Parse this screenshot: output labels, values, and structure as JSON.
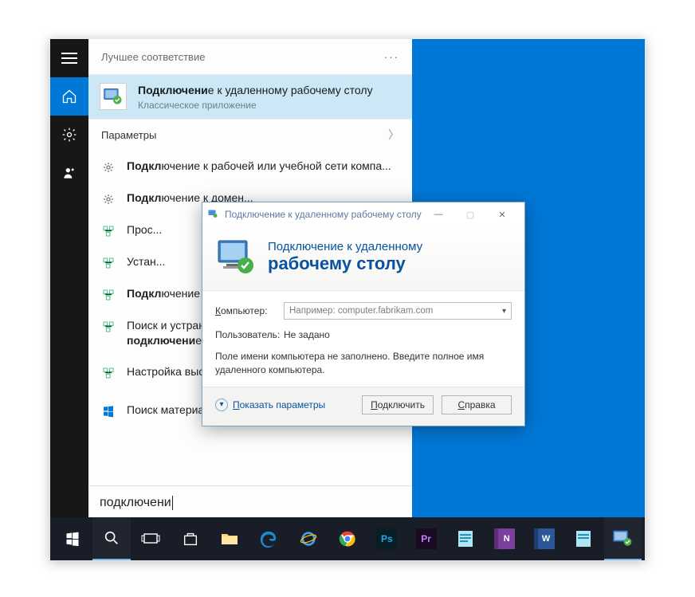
{
  "start": {
    "best_match_header": "Лучшее соответствие",
    "best_match_title_bold": "Подключени",
    "best_match_title_rest": "е к удаленному рабочему столу",
    "best_match_subtitle": "Классическое приложение",
    "params_header": "Параметры",
    "results": [
      "Подкл... компа...",
      "Подкл... домен...",
      "Прос...",
      "Устан...",
      "Подкл... стола...",
      "Поиск и устранение проблем с сетью и подключением",
      "Настройка высокоскоростного подключения"
    ],
    "store_header": "Поиск материалов",
    "search_query": "подключени"
  },
  "rdp": {
    "title": "Подключение к удаленному рабочему столу",
    "banner_line1": "Подключение к удаленному",
    "banner_line2": "рабочему столу",
    "label_computer": "Компьютер:",
    "label_computer_u": "К",
    "label_computer_rest": "омпьютер:",
    "combo_placeholder": "Например: computer.fabrikam.com",
    "label_user": "Пользователь:",
    "user_value": "Не задано",
    "hint": "Поле имени компьютера не заполнено. Введите полное имя удаленного компьютера.",
    "show_params": "Показать параметры",
    "show_params_u": "П",
    "show_params_rest": "оказать параметры",
    "btn_connect": "Подключить",
    "btn_connect_u": "П",
    "btn_connect_rest": "одключить",
    "btn_help": "Справка",
    "btn_help_u": "С",
    "btn_help_rest": "правка"
  },
  "taskbar": {
    "items": [
      {
        "name": "start",
        "color": "#ffffff"
      },
      {
        "name": "search",
        "color": "#ffffff"
      },
      {
        "name": "taskview",
        "color": "#ffffff"
      },
      {
        "name": "store",
        "color": "#ffffff"
      },
      {
        "name": "explorer",
        "color": "#ffd37a"
      },
      {
        "name": "edge",
        "color": "#3fa0e6"
      },
      {
        "name": "ie",
        "color": "#3fa0e6"
      },
      {
        "name": "chrome",
        "color": "#ffffff"
      },
      {
        "name": "photoshop",
        "color": "#2aa7df"
      },
      {
        "name": "premiere",
        "color": "#c77dff"
      },
      {
        "name": "doc1",
        "color": "#5fbfe0"
      },
      {
        "name": "onenote",
        "color": "#a05bc2"
      },
      {
        "name": "word",
        "color": "#2b579a"
      },
      {
        "name": "doc2",
        "color": "#5fbfe0"
      },
      {
        "name": "rdp",
        "color": "#ffffff"
      }
    ]
  }
}
